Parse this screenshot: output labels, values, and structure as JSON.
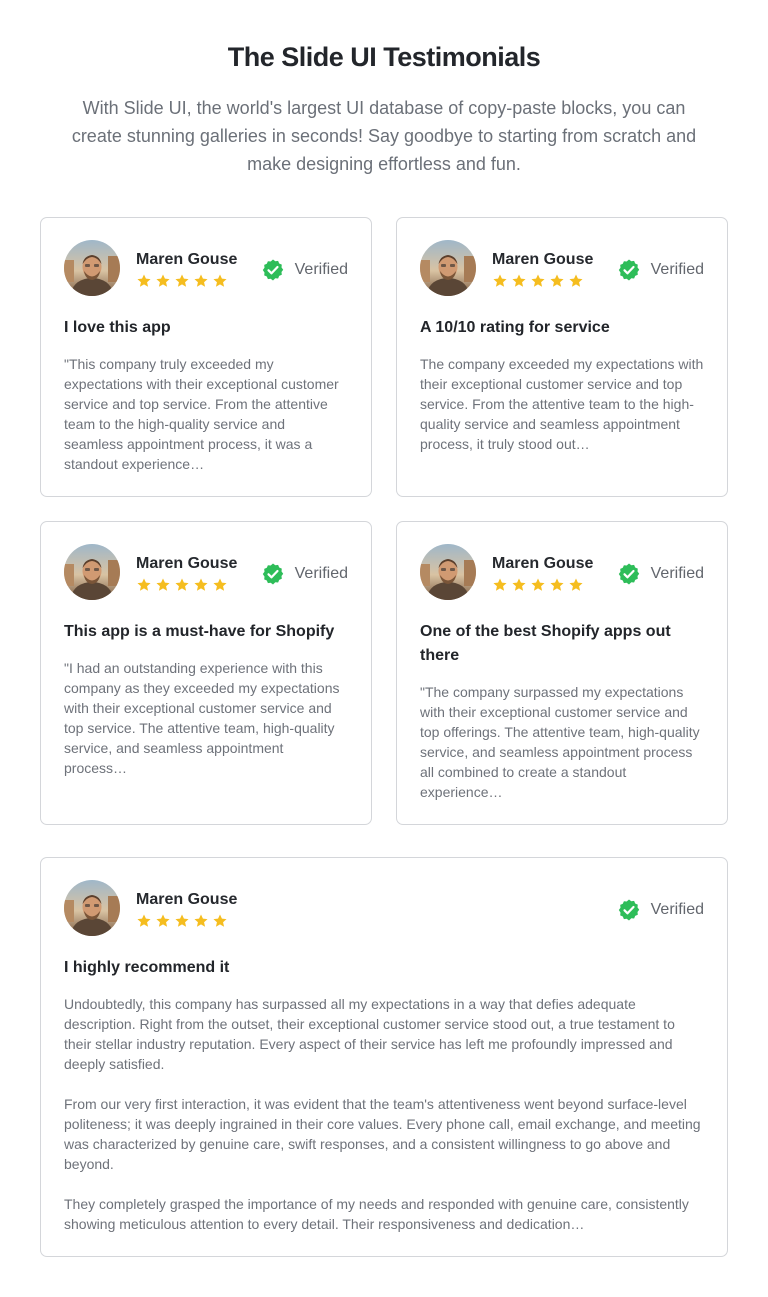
{
  "header": {
    "title": "The Slide UI Testimonials",
    "subtitle": "With Slide UI, the world's largest UI database of copy-paste blocks, you can create stunning galleries in seconds! Say goodbye to starting from scratch and make designing effortless and fun."
  },
  "colors": {
    "star": "#f5bd1f",
    "verified": "#2ebd59",
    "border": "#d4d6da"
  },
  "testimonials": [
    {
      "author": "Maren Gouse",
      "rating": 5,
      "verified_label": "Verified",
      "title": "I love this app",
      "body": [
        "\"This company truly exceeded my expectations with their exceptional customer service and top service. From the attentive team to the high-quality service and seamless appointment process, it was a standout experience…"
      ]
    },
    {
      "author": "Maren Gouse",
      "rating": 5,
      "verified_label": "Verified",
      "title": "A 10/10 rating for service",
      "body": [
        "The company exceeded my expectations with their exceptional customer service and top service. From the attentive team to the high-quality service and seamless appointment process, it truly stood out…"
      ]
    },
    {
      "author": "Maren Gouse",
      "rating": 5,
      "verified_label": "Verified",
      "title": "This app is a must-have for Shopify",
      "body": [
        "\"I had an outstanding experience with this company as they exceeded my expectations with their exceptional customer service and top service. The attentive team, high-quality service, and seamless appointment process…"
      ]
    },
    {
      "author": "Maren Gouse",
      "rating": 5,
      "verified_label": "Verified",
      "title": "One of the best Shopify apps out there",
      "body": [
        "\"The company surpassed my expectations with their exceptional customer service and top offerings. The attentive team, high-quality service, and seamless appointment process all combined to create a standout experience…"
      ]
    },
    {
      "author": "Maren Gouse",
      "rating": 5,
      "verified_label": "Verified",
      "title": "I highly recommend it",
      "body": [
        "Undoubtedly, this company has surpassed all my expectations in a way that defies adequate description. Right from the outset, their exceptional customer service stood out, a true testament to their stellar industry reputation. Every aspect of their service has left me profoundly impressed and deeply satisfied.",
        "From our very first interaction, it was evident that the team's attentiveness went beyond surface-level politeness; it was deeply ingrained in their core values. Every phone call, email exchange, and meeting was characterized by genuine care, swift responses, and a consistent willingness to go above and beyond.",
        "They completely grasped the importance of my needs and responded with genuine care, consistently showing meticulous attention to every detail. Their responsiveness and dedication…"
      ]
    }
  ]
}
